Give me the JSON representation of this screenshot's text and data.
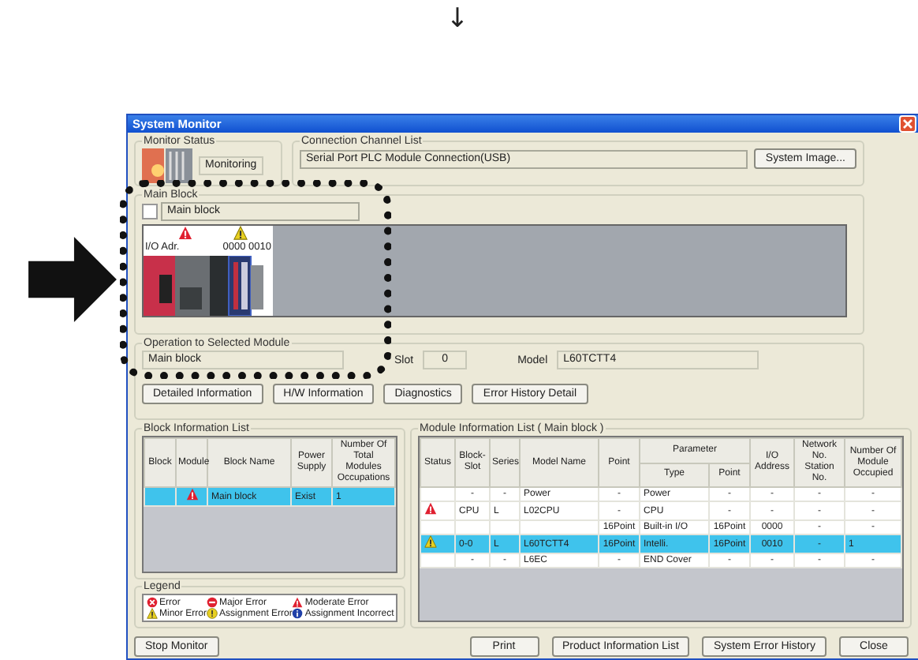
{
  "page_marker": "↓",
  "window": {
    "title": "System Monitor"
  },
  "monitor_status": {
    "label": "Monitor Status",
    "value": "Monitoring"
  },
  "connection": {
    "label": "Connection Channel List",
    "value": "Serial Port  PLC Module Connection(USB)",
    "button": "System Image..."
  },
  "main_block": {
    "label": "Main Block",
    "checkbox_label": "Main block",
    "checked": false
  },
  "rack": {
    "io_label": "I/O Adr.",
    "slots": [
      {
        "kind": "moderate"
      },
      {
        "kind": "minor",
        "address": "0000 0010"
      }
    ]
  },
  "operation": {
    "label": "Operation to Selected Module",
    "block": "Main block",
    "slot_label": "Slot",
    "slot": "0",
    "model_label": "Model",
    "model": "L60TCTT4",
    "buttons": [
      "Detailed Information",
      "H/W Information",
      "Diagnostics",
      "Error History Detail"
    ]
  },
  "block_list": {
    "label": "Block Information List",
    "columns": [
      "Block",
      "Module",
      "Block Name",
      "Power Supply",
      "Number Of Total Modules Occupations"
    ],
    "rows": [
      {
        "kind": "moderate",
        "name": "Main block",
        "power": "Exist",
        "count": "1",
        "selected": true
      }
    ]
  },
  "legend": {
    "label": "Legend",
    "items": [
      {
        "kind": "error",
        "text": "Error"
      },
      {
        "kind": "major",
        "text": "Major Error"
      },
      {
        "kind": "moderate",
        "text": "Moderate Error"
      },
      {
        "kind": "minor",
        "text": "Minor Error"
      },
      {
        "kind": "assignment_error",
        "text": "Assignment Error"
      },
      {
        "kind": "assignment_incorrect",
        "text": "Assignment Incorrect"
      }
    ]
  },
  "module_list": {
    "label": "Module Information List ( Main block )",
    "columns": {
      "status": "Status",
      "block_slot": "Block-Slot",
      "series": "Series",
      "model": "Model Name",
      "point": "Point",
      "parameter": "Parameter",
      "type": "Type",
      "param_point": "Point",
      "io": "I/O Address",
      "network": "Network No. Station No.",
      "occupied": "Number Of Module Occupied"
    },
    "rows": [
      {
        "block_slot": "-",
        "series": "-",
        "model": "Power",
        "point": "-",
        "type": "Power",
        "param_point": "-",
        "io": "-",
        "network": "-",
        "occupied": "-",
        "selected": false
      },
      {
        "kind": "moderate",
        "block_slot": "CPU",
        "series": "L",
        "model": "L02CPU",
        "point": "-",
        "type": "CPU",
        "param_point": "-",
        "io": "-",
        "network": "-",
        "occupied": "-",
        "selected": false
      },
      {
        "point": "16Point",
        "type": "Built-in I/O",
        "param_point": "16Point",
        "io": "0000",
        "network": "-",
        "occupied": "-",
        "selected": false
      },
      {
        "kind": "minor",
        "block_slot": "0-0",
        "series": "L",
        "model": "L60TCTT4",
        "point": "16Point",
        "type": "Intelli.",
        "param_point": "16Point",
        "io": "0010",
        "network": "-",
        "occupied": "1",
        "selected": true
      },
      {
        "block_slot": "-",
        "series": "-",
        "model": "L6EC",
        "point": "-",
        "type": "END Cover",
        "param_point": "-",
        "io": "-",
        "network": "-",
        "occupied": "-",
        "selected": false
      }
    ]
  },
  "footer_buttons": {
    "left": [
      "Stop Monitor"
    ],
    "right": [
      "Print",
      "Product Information List",
      "System Error History",
      "Close"
    ]
  }
}
